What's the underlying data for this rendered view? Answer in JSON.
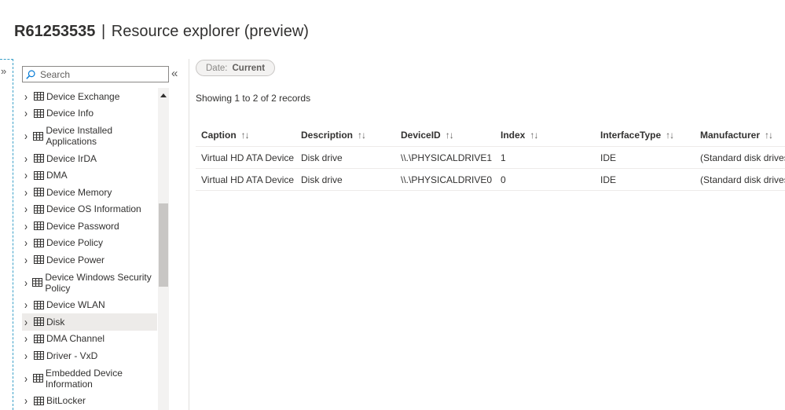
{
  "header": {
    "device_name": "R61253535",
    "separator": "|",
    "page_title": "Resource explorer (preview)"
  },
  "nav": {
    "expand_glyph": "»",
    "collapse_glyph": "«"
  },
  "search": {
    "placeholder": "Search",
    "icon": "search-icon"
  },
  "tree": {
    "items": [
      {
        "label": "Device Exchange",
        "lines": 1
      },
      {
        "label": "Device Info",
        "lines": 1
      },
      {
        "label": "Device Installed Applications",
        "lines": 2
      },
      {
        "label": "Device IrDA",
        "lines": 1
      },
      {
        "label": "DMA",
        "lines": 1
      },
      {
        "label": "Device Memory",
        "lines": 1
      },
      {
        "label": "Device OS Information",
        "lines": 1
      },
      {
        "label": "Device Password",
        "lines": 1
      },
      {
        "label": "Device Policy",
        "lines": 1
      },
      {
        "label": "Device Power",
        "lines": 1
      },
      {
        "label": "Device Windows Security Policy",
        "lines": 2
      },
      {
        "label": "Device WLAN",
        "lines": 1
      },
      {
        "label": "Disk",
        "lines": 1,
        "selected": true
      },
      {
        "label": "DMA Channel",
        "lines": 1
      },
      {
        "label": "Driver - VxD",
        "lines": 1
      },
      {
        "label": "Embedded Device Information",
        "lines": 2
      },
      {
        "label": "BitLocker",
        "lines": 1
      }
    ]
  },
  "filter": {
    "date_label": "Date:",
    "date_value": "Current"
  },
  "records_text": "Showing 1 to 2 of 2 records",
  "table": {
    "columns": [
      "Caption",
      "Description",
      "DeviceID",
      "Index",
      "InterfaceType",
      "Manufacturer"
    ],
    "sort_glyph": "↑↓",
    "rows": [
      [
        "Virtual HD ATA Device",
        "Disk drive",
        "\\\\.\\PHYSICALDRIVE1",
        "1",
        "IDE",
        "(Standard disk drives)"
      ],
      [
        "Virtual HD ATA Device",
        "Disk drive",
        "\\\\.\\PHYSICALDRIVE0",
        "0",
        "IDE",
        "(Standard disk drives)"
      ]
    ]
  },
  "colors": {
    "accent_dashed": "#3aa0c8",
    "selected_bg": "#edebe9"
  }
}
